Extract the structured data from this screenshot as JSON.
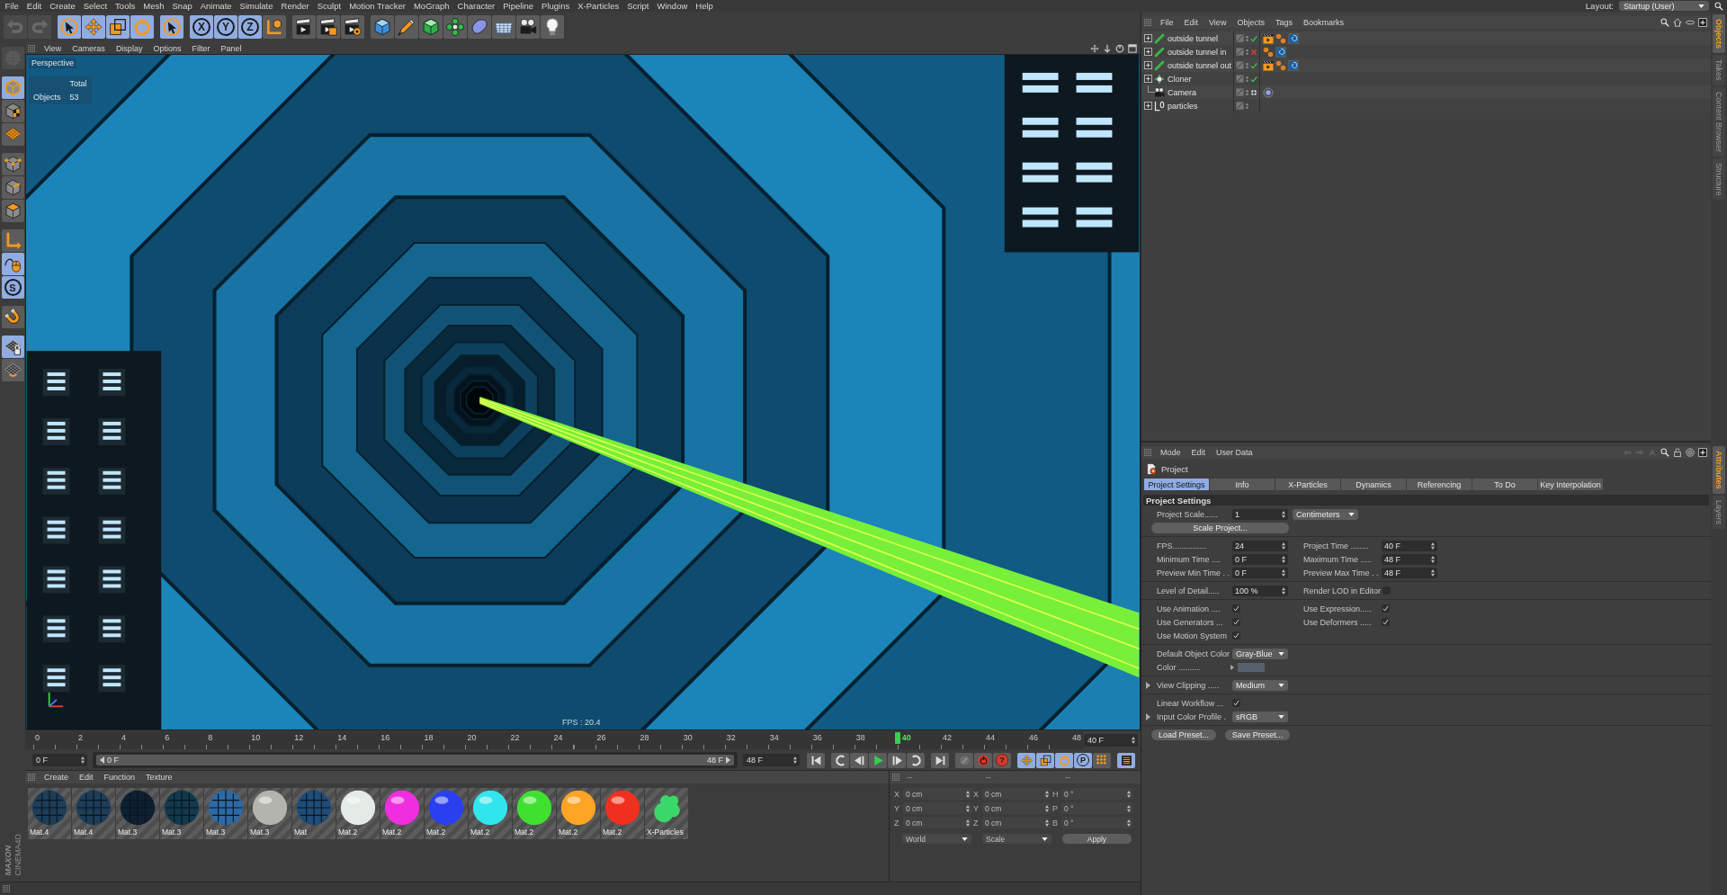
{
  "menu_bar": {
    "items": [
      "File",
      "Edit",
      "Create",
      "Select",
      "Tools",
      "Mesh",
      "Snap",
      "Animate",
      "Simulate",
      "Render",
      "Sculpt",
      "Motion Tracker",
      "MoGraph",
      "Character",
      "Pipeline",
      "Plugins",
      "X-Particles",
      "Script",
      "Window",
      "Help"
    ],
    "layout_label": "Layout:",
    "layout_value": "Startup (User)"
  },
  "toolbar": {
    "groups": [
      [
        {
          "kind": "undo",
          "on": false,
          "disabled": true
        },
        {
          "kind": "redo",
          "on": false,
          "disabled": true
        }
      ],
      [
        {
          "kind": "live-select",
          "on": true,
          "disabled": false
        },
        {
          "kind": "move",
          "on": true,
          "disabled": false
        },
        {
          "kind": "scale",
          "on": true,
          "disabled": false
        },
        {
          "kind": "rotate",
          "on": true,
          "disabled": false
        }
      ],
      [
        {
          "kind": "select",
          "on": true,
          "disabled": false
        }
      ],
      [
        {
          "kind": "x-axis",
          "label": "X",
          "on": true,
          "disabled": false
        },
        {
          "kind": "y-axis",
          "label": "Y",
          "on": true,
          "disabled": false
        },
        {
          "kind": "z-axis",
          "label": "Z",
          "on": true,
          "disabled": false
        },
        {
          "kind": "coord-system",
          "on": false,
          "disabled": false
        }
      ],
      [
        {
          "kind": "render-view",
          "on": false,
          "disabled": false
        },
        {
          "kind": "render-picture",
          "on": false,
          "disabled": false
        },
        {
          "kind": "render-settings",
          "on": false,
          "disabled": false
        }
      ],
      [
        {
          "kind": "cube",
          "on": false,
          "disabled": false
        },
        {
          "kind": "pen",
          "on": false,
          "disabled": false
        },
        {
          "kind": "subdivision",
          "on": false,
          "disabled": false
        },
        {
          "kind": "cloner",
          "on": false,
          "disabled": false
        },
        {
          "kind": "deformer",
          "on": false,
          "disabled": false
        },
        {
          "kind": "floor",
          "on": false,
          "disabled": false
        },
        {
          "kind": "camera",
          "on": false,
          "disabled": false
        },
        {
          "kind": "light",
          "on": false,
          "disabled": false
        }
      ]
    ]
  },
  "left_tools": {
    "groups": [
      [
        {
          "kind": "sculpt",
          "on": false,
          "disabled": true
        }
      ],
      [
        {
          "kind": "model",
          "on": true,
          "disabled": false
        },
        {
          "kind": "texture",
          "on": false,
          "disabled": false
        },
        {
          "kind": "workplane",
          "on": false,
          "disabled": false
        }
      ],
      [
        {
          "kind": "points",
          "on": false,
          "disabled": false
        },
        {
          "kind": "edges",
          "on": false,
          "disabled": false
        },
        {
          "kind": "polygons",
          "on": false,
          "disabled": false
        }
      ],
      [
        {
          "kind": "axis",
          "on": false,
          "disabled": false
        },
        {
          "kind": "tweak",
          "on": true,
          "disabled": false
        },
        {
          "kind": "solo",
          "label": "S",
          "on": true,
          "disabled": false
        }
      ],
      [
        {
          "kind": "snap",
          "on": false,
          "disabled": false
        }
      ],
      [
        {
          "kind": "workplane-lock",
          "on": true,
          "disabled": false
        },
        {
          "kind": "locked-workplane",
          "on": false,
          "disabled": false
        }
      ]
    ]
  },
  "viewport": {
    "menu": [
      "View",
      "Cameras",
      "Display",
      "Options",
      "Filter",
      "Panel"
    ],
    "camera": "Perspective",
    "stats_header": "Total",
    "stats_label": "Objects",
    "stats_value": "53",
    "fps": "FPS : 20.4"
  },
  "timeline": {
    "ticks": [
      "0",
      "2",
      "4",
      "6",
      "8",
      "10",
      "12",
      "14",
      "16",
      "18",
      "20",
      "22",
      "24",
      "26",
      "28",
      "30",
      "32",
      "34",
      "36",
      "38",
      "40",
      "42",
      "44",
      "46",
      "48"
    ],
    "playhead": {
      "level": 0.8333
    },
    "current_frame": "40 F",
    "start_frame": "0 F",
    "preview_range": {
      "start": "0 F",
      "end": "48 F",
      "level": 1
    },
    "end_frame": "48 F"
  },
  "transport": {
    "groups": [
      [
        {
          "kind": "first",
          "on": false
        }
      ],
      [
        {
          "kind": "prev-key",
          "on": false
        },
        {
          "kind": "prev-frame",
          "on": false
        },
        {
          "kind": "play",
          "on": false
        },
        {
          "kind": "next-frame",
          "on": false
        },
        {
          "kind": "next-key",
          "on": false
        }
      ],
      [
        {
          "kind": "last",
          "on": false
        }
      ],
      [
        {
          "kind": "record",
          "on": false
        },
        {
          "kind": "autokey",
          "on": false
        },
        {
          "kind": "key-selection",
          "label": "?",
          "on": false
        }
      ],
      [
        {
          "kind": "key-move",
          "on": true
        },
        {
          "kind": "key-scale",
          "on": true
        },
        {
          "kind": "key-rotate",
          "on": true
        },
        {
          "kind": "key-param",
          "label": "P",
          "on": true
        },
        {
          "kind": "key-grid",
          "on": false
        }
      ],
      [
        {
          "kind": "timeline",
          "on": true
        }
      ]
    ]
  },
  "materials": {
    "menu": [
      "Create",
      "Edit",
      "Function",
      "Texture"
    ],
    "items": [
      {
        "name": "Mat.4",
        "kind": "textured",
        "color": "#1e3d58"
      },
      {
        "name": "Mat.4",
        "kind": "textured",
        "color": "#1e3d58"
      },
      {
        "name": "Mat.3",
        "kind": "textured",
        "color": "#0e2030"
      },
      {
        "name": "Mat.3",
        "kind": "textured",
        "color": "#12394c"
      },
      {
        "name": "Mat.3",
        "kind": "textured",
        "color": "#2d6aa5"
      },
      {
        "name": "Mat.3",
        "kind": "glossy",
        "color": "#b4b4ae"
      },
      {
        "name": "Mat",
        "kind": "textured",
        "color": "#1d4d78"
      },
      {
        "name": "Mat.2",
        "kind": "glossy",
        "color": "#e4eae6"
      },
      {
        "name": "Mat.2",
        "kind": "glossy",
        "color": "#f02ee0"
      },
      {
        "name": "Mat.2",
        "kind": "glossy",
        "color": "#2a40f0"
      },
      {
        "name": "Mat.2",
        "kind": "glossy",
        "color": "#30e6ec"
      },
      {
        "name": "Mat.2",
        "kind": "glossy",
        "color": "#40e030"
      },
      {
        "name": "Mat.2",
        "kind": "glossy",
        "color": "#ffa424"
      },
      {
        "name": "Mat.2",
        "kind": "glossy",
        "color": "#f0301e"
      },
      {
        "name": "X-Particles",
        "kind": "splat",
        "color": "#3ad868"
      }
    ]
  },
  "coordinates": {
    "headers": [
      "--",
      "--",
      "--"
    ],
    "rows": [
      [
        {
          "axis": "X",
          "value": "0 cm"
        },
        {
          "axis": "X",
          "value": "0 cm"
        },
        {
          "axis": "H",
          "value": "0 °"
        }
      ],
      [
        {
          "axis": "Y",
          "value": "0 cm"
        },
        {
          "axis": "Y",
          "value": "0 cm"
        },
        {
          "axis": "P",
          "value": "0 °"
        }
      ],
      [
        {
          "axis": "Z",
          "value": "0 cm"
        },
        {
          "axis": "Z",
          "value": "0 cm"
        },
        {
          "axis": "B",
          "value": "0 °"
        }
      ]
    ],
    "mode": "World",
    "transform": "Scale",
    "apply": "Apply",
    "disabled": true
  },
  "objects": {
    "menu": [
      "File",
      "Edit",
      "View",
      "Objects",
      "Tags",
      "Bookmarks"
    ],
    "items": [
      {
        "name": "outside tunnel",
        "kind": "emitter",
        "has_children": true,
        "toggle": {
          "kind": "enable",
          "on": true
        },
        "tags": [
          {
            "kind": "clapper"
          },
          {
            "kind": "spheres"
          },
          {
            "kind": "swirl"
          }
        ]
      },
      {
        "name": "outside tunnel in",
        "kind": "emitter",
        "has_children": true,
        "toggle": {
          "kind": "enable",
          "on": false
        },
        "tags": [
          {
            "kind": "spheres"
          },
          {
            "kind": "swirl"
          }
        ]
      },
      {
        "name": "outside tunnel out",
        "kind": "emitter",
        "has_children": true,
        "toggle": {
          "kind": "enable",
          "on": true
        },
        "tags": [
          {
            "kind": "clapper"
          },
          {
            "kind": "spheres"
          },
          {
            "kind": "swirl"
          }
        ]
      },
      {
        "name": "Cloner",
        "kind": "cloner",
        "has_children": true,
        "toggle": {
          "kind": "enable",
          "on": true
        }
      },
      {
        "name": "Camera",
        "kind": "camera",
        "has_children": false,
        "toggle": {
          "kind": "camera-switch",
          "on": false
        },
        "tags": [
          {
            "kind": "target"
          }
        ]
      },
      {
        "name": "particles",
        "kind": "null",
        "has_children": true
      }
    ]
  },
  "attributes": {
    "menu": [
      "Mode",
      "Edit",
      "User Data"
    ],
    "object": "Project",
    "tabs": [
      {
        "label": "Project Settings",
        "selected": true
      },
      {
        "label": "Info",
        "selected": false
      },
      {
        "label": "X-Particles",
        "selected": false
      },
      {
        "label": "Dynamics",
        "selected": false
      },
      {
        "label": "Referencing",
        "selected": false
      },
      {
        "label": "To Do",
        "selected": false
      },
      {
        "label": "Key Interpolation",
        "selected": false
      }
    ],
    "section": "Project Settings",
    "groups": [
      [
        {
          "expandable": false,
          "fields": [
            {
              "kind": "scale",
              "label": "Project Scale......",
              "value": "1",
              "unit": "Centimeters"
            }
          ]
        },
        {
          "expandable": false,
          "fields": [
            {
              "kind": "button",
              "label": "Scale Project..."
            }
          ]
        }
      ],
      [
        {
          "expandable": false,
          "fields": [
            {
              "kind": "number",
              "label": "FPS...............",
              "value": "24"
            },
            {
              "kind": "number",
              "label": "Project Time ........",
              "value": "40 F"
            }
          ]
        },
        {
          "expandable": false,
          "fields": [
            {
              "kind": "number",
              "label": "Minimum Time ....",
              "value": "0 F"
            },
            {
              "kind": "number",
              "label": "Maximum Time .....",
              "value": "48 F"
            }
          ]
        },
        {
          "expandable": false,
          "fields": [
            {
              "kind": "number",
              "label": "Preview Min Time . .",
              "value": "0 F"
            },
            {
              "kind": "number",
              "label": "Preview Max Time . .",
              "value": "48 F"
            }
          ]
        }
      ],
      [
        {
          "expandable": false,
          "fields": [
            {
              "kind": "number",
              "label": "Level of Detail.....",
              "value": "100 %"
            },
            {
              "kind": "check",
              "label": "Render LOD in Editor",
              "checked": false
            }
          ]
        }
      ],
      [
        {
          "expandable": false,
          "fields": [
            {
              "kind": "check",
              "label": "Use Animation ....",
              "checked": true
            },
            {
              "kind": "check",
              "label": "Use Expression.....",
              "checked": true
            }
          ]
        },
        {
          "expandable": false,
          "fields": [
            {
              "kind": "check",
              "label": "Use Generators ...",
              "checked": true
            },
            {
              "kind": "check",
              "label": "Use Deformers .....",
              "checked": true
            }
          ]
        },
        {
          "expandable": false,
          "fields": [
            {
              "kind": "check",
              "label": "Use Motion System",
              "checked": true
            }
          ]
        }
      ],
      [
        {
          "expandable": false,
          "fields": [
            {
              "kind": "dropdown",
              "label": "Default Object Color",
              "value": "Gray-Blue"
            }
          ]
        },
        {
          "expandable": false,
          "fields": [
            {
              "kind": "color",
              "label": "Color ..........",
              "color": "#57616c"
            }
          ]
        }
      ],
      [
        {
          "expandable": true,
          "fields": [
            {
              "kind": "dropdown",
              "label": "View Clipping .....",
              "value": "Medium"
            }
          ]
        }
      ],
      [
        {
          "expandable": false,
          "fields": [
            {
              "kind": "check",
              "label": "Linear Workflow ...",
              "checked": true
            }
          ]
        },
        {
          "expandable": true,
          "fields": [
            {
              "kind": "dropdown",
              "label": "Input Color Profile .",
              "value": "sRGB"
            }
          ]
        }
      ],
      [
        {
          "expandable": false,
          "fields": [
            {
              "kind": "button",
              "label": "Load Preset..."
            },
            {
              "kind": "button",
              "label": "Save Preset..."
            }
          ]
        }
      ]
    ]
  },
  "side_tabs": {
    "top": [
      {
        "label": "Objects",
        "selected": true
      },
      {
        "label": "Takes",
        "selected": false
      },
      {
        "label": "Content Browser",
        "selected": false
      },
      {
        "label": "Structure",
        "selected": false
      }
    ],
    "bottom": [
      {
        "label": "Attributes",
        "selected": true
      },
      {
        "label": "Layers",
        "selected": false
      }
    ]
  },
  "branding": {
    "company": "MAXON",
    "product": "CINEMA4D"
  }
}
